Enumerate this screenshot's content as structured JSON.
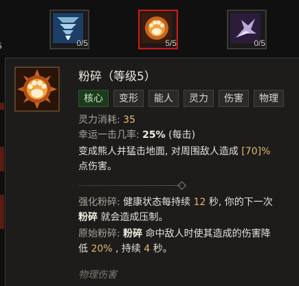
{
  "skill_strip": {
    "stray_rank": "5",
    "skills": [
      {
        "name": "tornado-skill",
        "rank": "0/5"
      },
      {
        "name": "pulverize-skill",
        "rank": "5/5",
        "selected": true
      },
      {
        "name": "wolf-skill",
        "rank": "0/5"
      }
    ]
  },
  "tooltip": {
    "title": "粉碎（等级5）",
    "tags": [
      "核心",
      "变形",
      "能人",
      "灵力",
      "伤害",
      "物理"
    ],
    "cost_label": "灵力消耗:",
    "cost_value": "35",
    "lucky_label": "幸运一击几率:",
    "lucky_value": "25%",
    "lucky_suffix": "(每击)",
    "desc_line1_a": "变成熊人并猛击地面, 对周围敌人造成",
    "desc_line1_b": "[70]%",
    "desc_line2": "点伤害。",
    "enh_label": "强化粉碎:",
    "enh_text_a": "健康状态每持续",
    "enh_num": "12",
    "enh_text_b": "秒, 你的下一次",
    "enh_line2_bold": "粉碎",
    "enh_line2_text": "就会造成压制。",
    "prim_label": "原始粉碎:",
    "prim_bold": "粉碎",
    "prim_text": "命中敌人时使其造成的伤害降",
    "prim_line2_a": "低",
    "prim_line2_num": "20%",
    "prim_line2_b": ", 持续",
    "prim_line2_num2": "4",
    "prim_line2_c": "秒。",
    "footer": "物理伤害"
  },
  "colors": {
    "selected_border": "#c0201a",
    "highlight": "#e9c46a",
    "core_tag_bg": "#1c3a1c"
  }
}
